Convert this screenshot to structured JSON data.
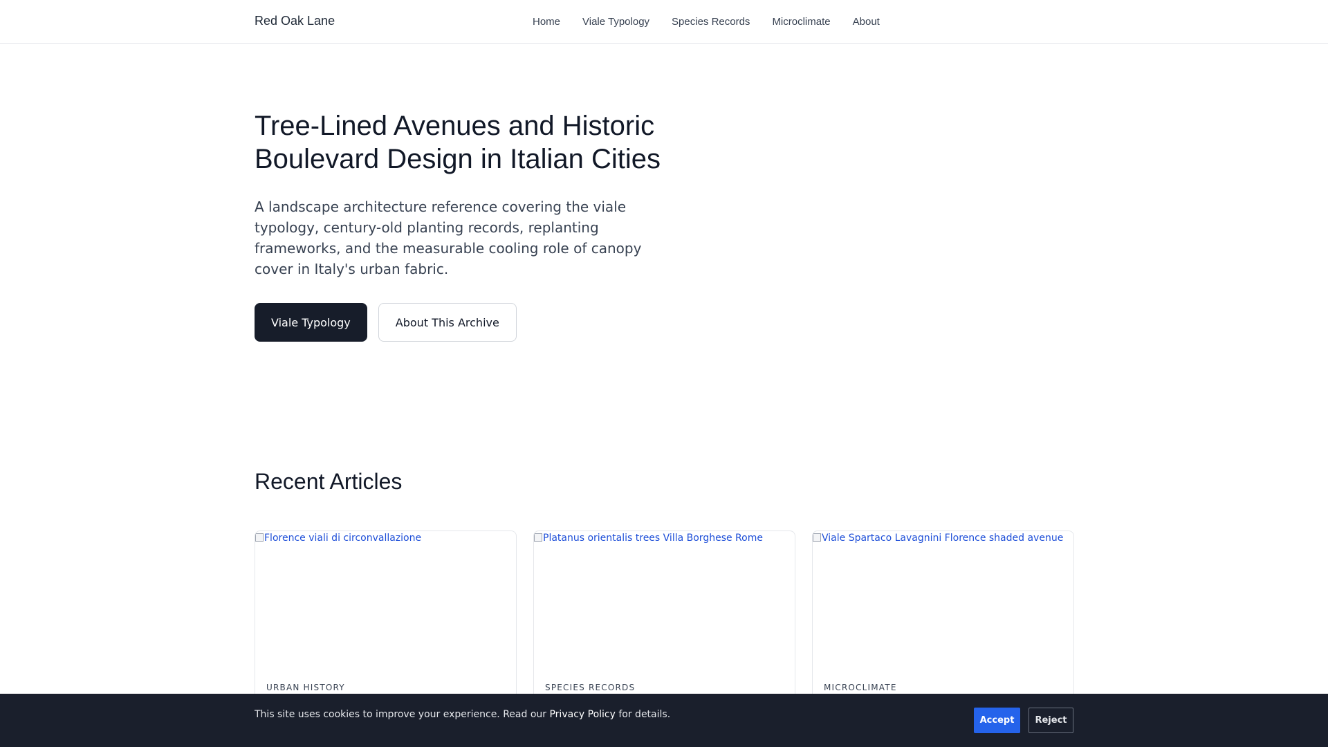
{
  "nav": {
    "brand": "Red Oak Lane",
    "links": [
      "Home",
      "Viale Typology",
      "Species Records",
      "Microclimate",
      "About"
    ]
  },
  "hero": {
    "title": "Tree-Lined Avenues and Historic Boulevard Design in Italian Cities",
    "lead": "A landscape architecture reference covering the viale typology, century-old planting records, replanting frameworks, and the measurable cooling role of canopy cover in Italy's urban fabric.",
    "primary_button": "Viale Typology",
    "secondary_button": "About This Archive"
  },
  "articles": {
    "section_title": "Recent Articles",
    "cards": [
      {
        "image_alt": "Florence viali di circonvallazione",
        "category": "URBAN HISTORY"
      },
      {
        "image_alt": "Platanus orientalis trees Villa Borghese Rome",
        "category": "SPECIES RECORDS"
      },
      {
        "image_alt": "Viale Spartaco Lavagnini Florence shaded avenue",
        "category": "MICROCLIMATE"
      }
    ]
  },
  "cookie": {
    "text_before": "This site uses cookies to improve your experience. Read our ",
    "link": "Privacy Policy",
    "text_after": " for details.",
    "accept": "Accept",
    "reject": "Reject"
  },
  "colors": {
    "primary_button": "#171d2a",
    "cookie_background": "#1a1f2c",
    "accept_button": "#2563eb",
    "link": "#1d4ed8"
  }
}
